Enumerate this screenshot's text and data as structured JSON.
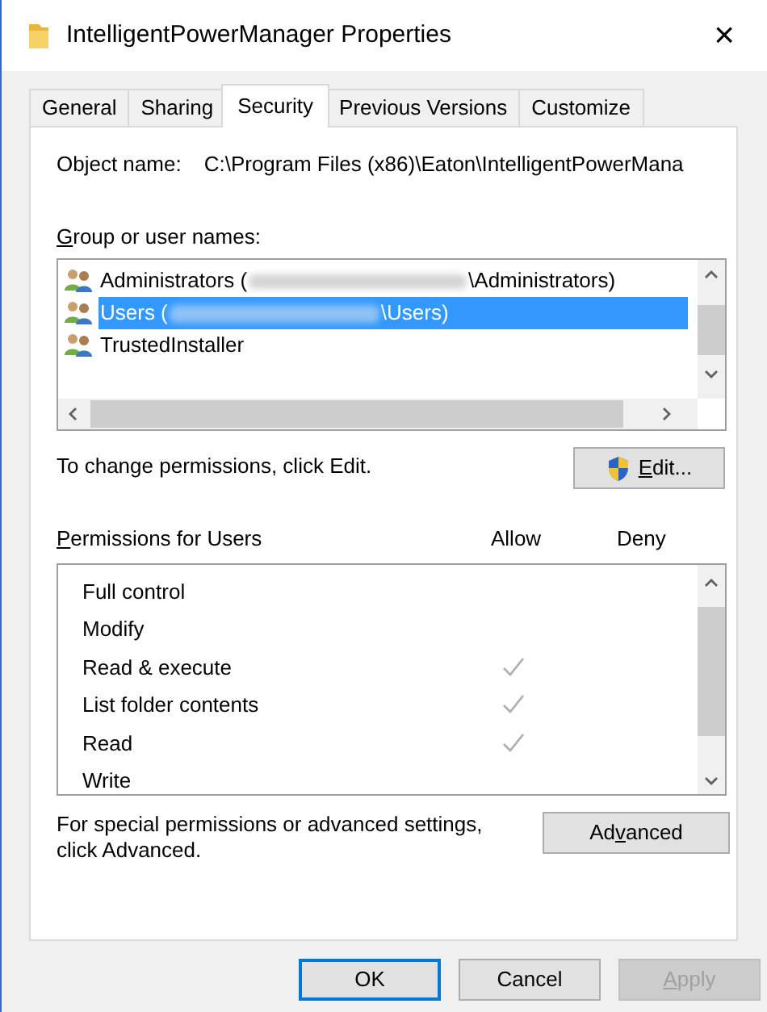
{
  "window": {
    "title": "IntelligentPowerManager Properties",
    "close": "×"
  },
  "tabs": [
    {
      "label": "General",
      "selected": false
    },
    {
      "label": "Sharing",
      "selected": false
    },
    {
      "label": "Security",
      "selected": true
    },
    {
      "label": "Previous Versions",
      "selected": false
    },
    {
      "label": "Customize",
      "selected": false
    }
  ],
  "object_name": {
    "label": "Object name:",
    "value": "C:\\Program Files (x86)\\Eaton\\IntelligentPowerMana"
  },
  "group_list": {
    "label": {
      "key": "G",
      "after": "roup or user names:"
    },
    "items": [
      {
        "text_before": "Administrators (",
        "redacted": true,
        "text_after": "\\Administrators)",
        "selected": false
      },
      {
        "text_before": "Users (",
        "redacted": true,
        "text_after": "\\Users)",
        "selected": true
      },
      {
        "text_before": "TrustedInstaller",
        "redacted": false,
        "selected": false
      }
    ]
  },
  "change_hint": "To change permissions, click Edit.",
  "edit_button": {
    "key": "E",
    "after": "dit..."
  },
  "permissions": {
    "label": {
      "key": "P",
      "after": "ermissions for Users"
    },
    "allow_header": "Allow",
    "deny_header": "Deny",
    "rows": [
      {
        "name": "Full control",
        "allow": false,
        "deny": false
      },
      {
        "name": "Modify",
        "allow": false,
        "deny": false
      },
      {
        "name": "Read & execute",
        "allow": true,
        "deny": false
      },
      {
        "name": "List folder contents",
        "allow": true,
        "deny": false
      },
      {
        "name": "Read",
        "allow": true,
        "deny": false
      },
      {
        "name": "Write",
        "allow": false,
        "deny": false
      }
    ]
  },
  "advanced_hint": "For special permissions or advanced settings, click Advanced.",
  "advanced_button": {
    "before": "Ad",
    "key": "v",
    "after": "anced"
  },
  "buttons": [
    {
      "label": {
        "after": "OK"
      },
      "default": true,
      "disabled": false
    },
    {
      "label": {
        "after": "Cancel"
      },
      "default": false,
      "disabled": false
    },
    {
      "label": {
        "key": "A",
        "after": "pply"
      },
      "default": false,
      "disabled": true
    }
  ]
}
